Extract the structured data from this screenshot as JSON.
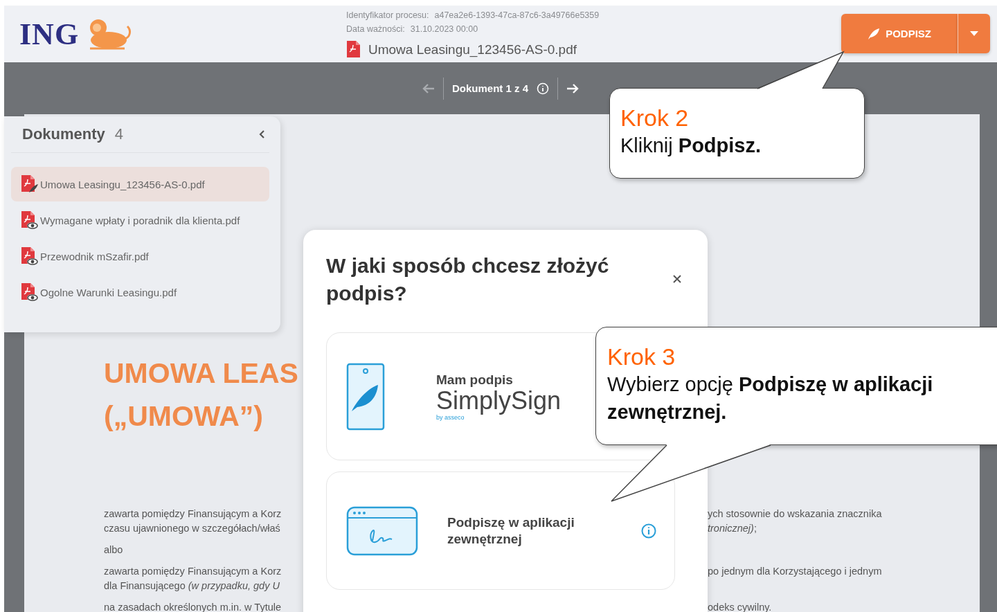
{
  "header": {
    "logo_text": "ING",
    "process_id_label": "Identyfikator procesu:",
    "process_id": "a47ea2e6-1393-47ca-87c6-3a49766e5359",
    "expiry_label": "Data ważności:",
    "expiry": "31.10.2023 00:00",
    "file_name": "Umowa Leasingu_123456-AS-0.pdf",
    "sign_button": "PODPISZ"
  },
  "navigator": {
    "label": "Dokument 1 z 4",
    "prev_disabled": true
  },
  "documents_panel": {
    "title": "Dokumenty",
    "count": "4",
    "items": [
      {
        "name": "Umowa Leasingu_123456-AS-0.pdf",
        "kind": "sign",
        "selected": true
      },
      {
        "name": "Wymagane wpłaty i poradnik dla klienta.pdf",
        "kind": "view",
        "selected": false
      },
      {
        "name": "Przewodnik mSzafir.pdf",
        "kind": "view",
        "selected": false
      },
      {
        "name": "Ogolne Warunki Leasingu.pdf",
        "kind": "view",
        "selected": false
      }
    ]
  },
  "document": {
    "title_lines": [
      "UMOWA LEAS",
      "(„UMOWA”)"
    ],
    "paragraphs": [
      {
        "lines": [
          {
            "left": "zawarta pomiędzy Finansującym a Korz",
            "right": "ych stosownie do wskazania znacznika"
          },
          {
            "left": "czasu ujawnionego w szczegółach/właś",
            "right": "*tronicznej)*;"
          }
        ]
      },
      {
        "lines": [
          {
            "left": "albo"
          }
        ]
      },
      {
        "lines": [
          {
            "left": "zawarta pomiędzy Finansującym a Korz",
            "right": "po jednym dla Korzystającego i jednym"
          },
          {
            "left": "dla Finansującego *(w przypadku, gdy U*"
          }
        ]
      },
      {
        "lines": [
          {
            "left": "na zasadach określonych m.in. w Tytule",
            "right": "odeks cywilny."
          }
        ]
      }
    ]
  },
  "dialog": {
    "title": "W jaki sposób chcesz złożyć podpis?",
    "options": [
      {
        "kind": "simplysign",
        "caption": "Mam podpis",
        "logo_text": "SimplySign",
        "logo_byline": "by asseco"
      },
      {
        "kind": "external",
        "label": "Podpiszę w aplikacji zewnętrznej"
      }
    ]
  },
  "callouts": [
    {
      "heading": "Krok 2",
      "text": "Kliknij **Podpisz.**"
    },
    {
      "heading": "Krok 3",
      "text": "Wybierz opcję **Podpiszę w aplikacji zewnętrznej.**"
    }
  ]
}
